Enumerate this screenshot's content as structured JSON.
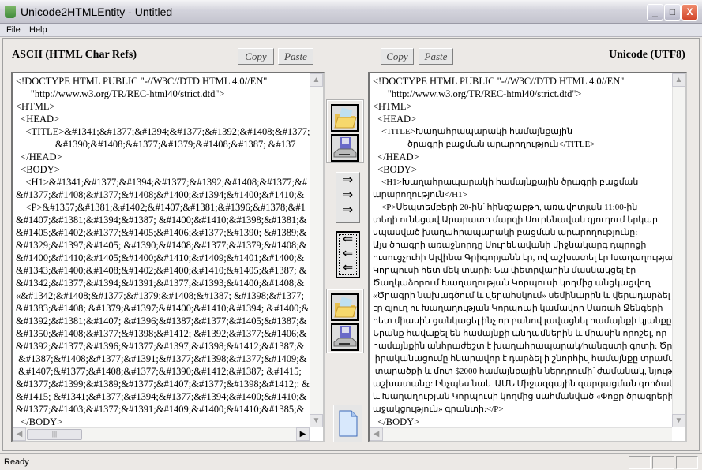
{
  "window": {
    "title": "Unicode2HTMLEntity - Untitled",
    "minimize": "_",
    "maximize": "□",
    "close": "X"
  },
  "menu": [
    "File",
    "Help"
  ],
  "left": {
    "label": "ASCII (HTML Char Refs)",
    "copy": "Copy",
    "paste": "Paste",
    "lines": [
      "<!DOCTYPE HTML PUBLIC \"-//W3C//DTD HTML 4.0//EN\"",
      "      \"http://www.w3.org/TR/REC-html40/strict.dtd\">",
      "<HTML>",
      "  <HEAD>",
      "    <TITLE>&#1341;&#1377;&#1394;&#1377;&#1392;&#1408;&#1377;",
      "                &#1390;&#1408;&#1377;&#1379;&#1408;&#1387; &#137",
      "  </HEAD>",
      "  <BODY>",
      "    <H1>&#1341;&#1377;&#1394;&#1377;&#1392;&#1408;&#1377;&#",
      "&#1377;&#1408;&#1377;&#1408;&#1400;&#1394;&#1400;&#1410;&",
      "    <P>&#1357;&#1381;&#1402;&#1407;&#1381;&#1396;&#1378;&#1",
      "&#1407;&#1381;&#1394;&#1387; &#1400;&#1410;&#1398;&#1381;&",
      "&#1405;&#1402;&#1377;&#1405;&#1406;&#1377;&#1390; &#1389;&",
      "&#1329;&#1397;&#1405; &#1390;&#1408;&#1377;&#1379;&#1408;&",
      "&#1400;&#1410;&#1405;&#1400;&#1410;&#1409;&#1401;&#1400;&",
      "&#1343;&#1400;&#1408;&#1402;&#1400;&#1410;&#1405;&#1387; &",
      "&#1342;&#1377;&#1394;&#1391;&#1377;&#1393;&#1400;&#1408;&",
      "«&#1342;&#1408;&#1377;&#1379;&#1408;&#1387; &#1398;&#1377;",
      "&#1383;&#1408; &#1379;&#1397;&#1400;&#1410;&#1394; &#1400;&",
      "&#1392;&#1381;&#1407; &#1396;&#1387;&#1377;&#1405;&#1387;&",
      "&#1350;&#1408;&#1377;&#1398;&#1412; &#1392;&#1377;&#1406;&",
      "&#1392;&#1377;&#1396;&#1377;&#1397;&#1398;&#1412;&#1387;&",
      " &#1387;&#1408;&#1377;&#1391;&#1377;&#1398;&#1377;&#1409;&",
      " &#1407;&#1377;&#1408;&#1377;&#1390;&#1412;&#1387; &#1415;",
      "&#1377;&#1399;&#1389;&#1377;&#1407;&#1377;&#1398;&#1412;: &",
      "&#1415; &#1341;&#1377;&#1394;&#1377;&#1394;&#1400;&#1410;&",
      "&#1377;&#1403;&#1377;&#1391;&#1409;&#1400;&#1410;&#1385;&",
      "  </BODY>",
      "</HTML>"
    ]
  },
  "right": {
    "label": "Unicode (UTF8)",
    "copy": "Copy",
    "paste": "Paste",
    "lines": [
      "<!DOCTYPE HTML PUBLIC \"-//W3C//DTD HTML 4.0//EN\"",
      "      \"http://www.w3.org/TR/REC-html40/strict.dtd\">",
      "<HTML>",
      "  <HEAD>",
      "    <TITLE>Խաղահրապարակի համայնքային",
      "                ծրագրի բացման արարողություն</TITLE>",
      "  </HEAD>",
      "  <BODY>",
      "    <H1>Խաղահրապարակի համայնքային ծրագրի բացման",
      "արարողություն</H1>",
      "    <P>Սեպտեմբերի 20-ին՝ հինգշաբթի, առավոտյան 11:00-ին",
      "տեղի ունեցավ Արարատի մարզի Սուրենավան գյուղում երկար",
      "սպասված խաղահրապարակի բացման արարողությունը:",
      "Այս ծրագրի առաջնորդը Սուրենավանի միջնակարգ դպրոցի",
      "ուսուցչուհի Ալվինա Գրիգորյանն էր, ով աշխատել էր Խաղաղության",
      "Կորպուսի հետ մեկ տարի: Նա փետրվարին մասնակցել էր",
      "Ծաղկաձորում Խաղաղության Կորպուսի կողմից անցկացվող",
      "«Ծրագրի նախագծում և վերահսկում» սեմինարին և վերադարձել",
      "էր գյուղ ու Խաղաղության Կորպուսի կամավոր Սառահ Ջենգերի",
      "հետ միասին ցանկացել ինչ որ բանով լավացնել համայնքի կյանքը:",
      "Նրանք հավաքել են համայնքի անդամներին և միասին որոշել, որ",
      "համայնքին անհրաժեշտ է խաղահրապարակ/հանգստի գոտի: Ծրագրի",
      " իրականացումը հնարավոր է դարձել ի շնորհիվ համայնքը տրամադրած",
      " տարածքի և մոտ $2000 համայնքային ներդրումի՝ ժամանակ, նյութեր և",
      "աշխատանք: Ինչպես նաև ԱՄՆ Միջազգային զարգացման գործակալության",
      "և Խաղաղության Կորպուսի կողմից սահմանված «Փոքր ծրագրերի",
      "աջակցություն» գրանտի:</P>",
      "  </BODY>",
      "</HTML>"
    ]
  },
  "middle": {
    "arrow_right": "⇒",
    "arrow_left": "⇐",
    "icons": [
      "open-folder-icon",
      "save-disk-icon",
      "new-document-icon"
    ]
  },
  "status": {
    "text": "Ready"
  }
}
